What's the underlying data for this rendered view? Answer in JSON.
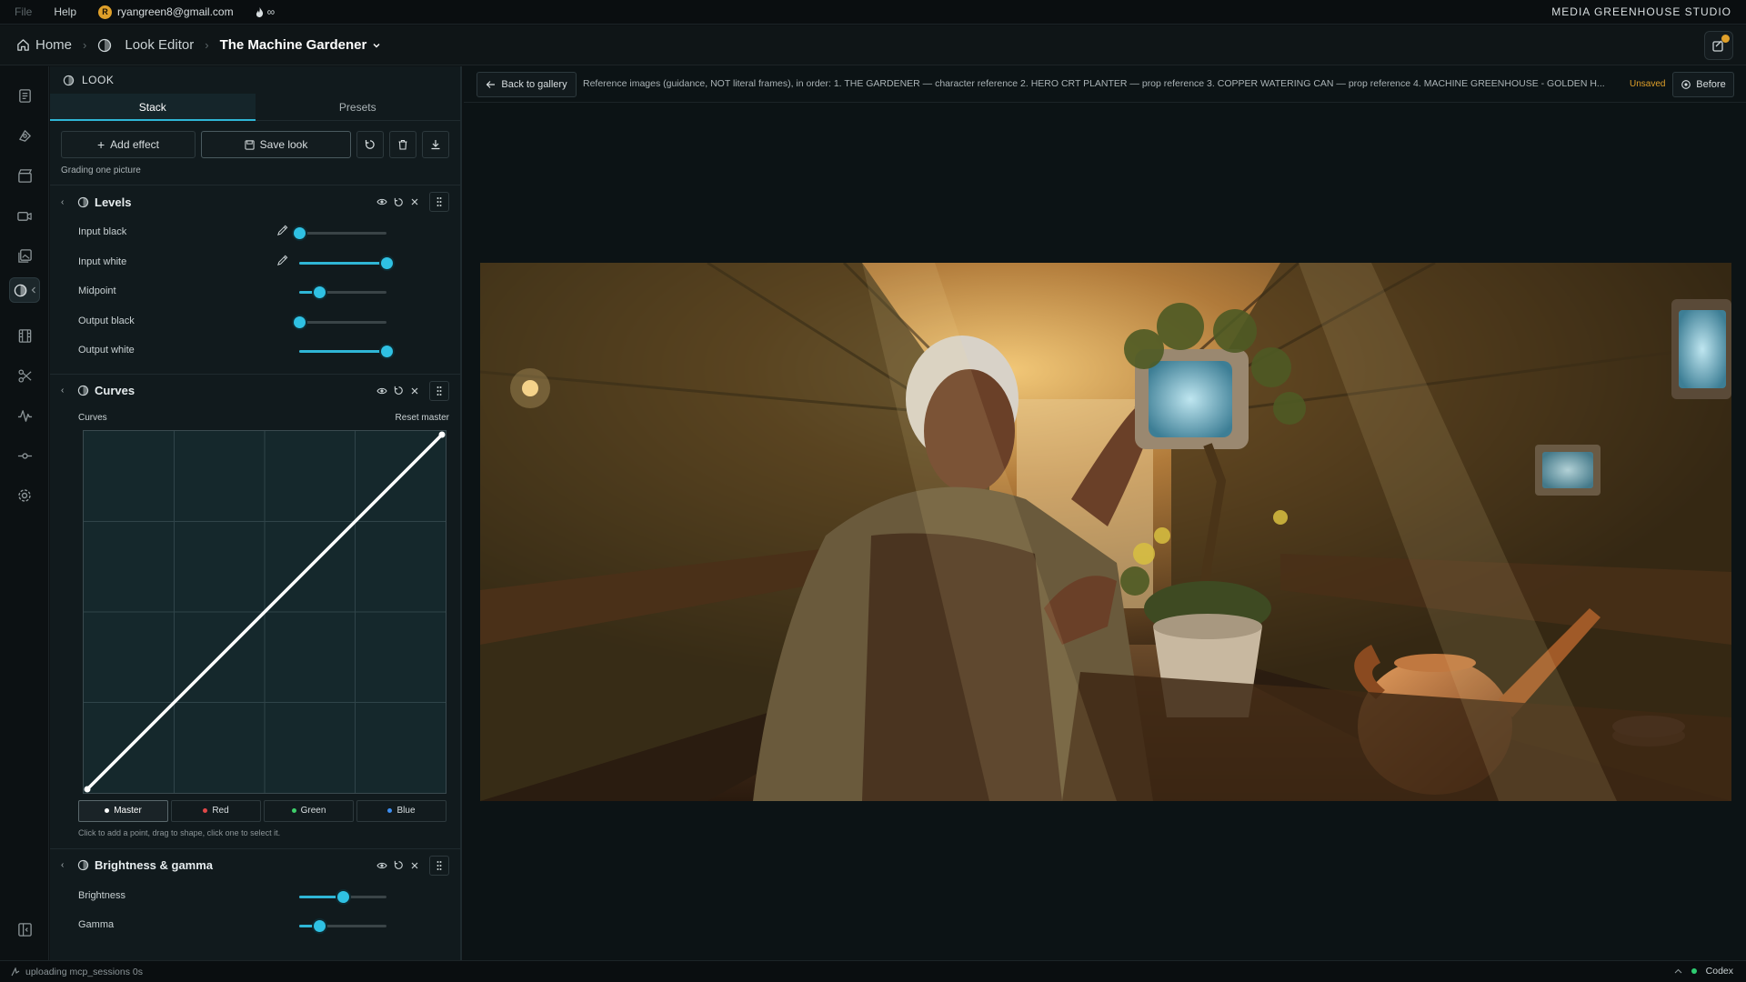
{
  "menubar": {
    "file": "File",
    "help": "Help",
    "user_initial": "R",
    "user_email": "ryangreen8@gmail.com",
    "credits": "∞",
    "studio": "MEDIA GREENHOUSE STUDIO"
  },
  "breadcrumb": {
    "home": "Home",
    "look_editor": "Look Editor",
    "project": "The Machine Gardener"
  },
  "panel": {
    "title": "LOOK",
    "tabs": [
      "Stack",
      "Presets"
    ],
    "add_effect": "Add effect",
    "save_look": "Save look",
    "caption": "Grading one picture"
  },
  "levels": {
    "title": "Levels",
    "rows": [
      {
        "label": "Input black",
        "value": 0
      },
      {
        "label": "Input white",
        "value": 1
      },
      {
        "label": "Midpoint",
        "value": 0.23
      },
      {
        "label": "Output black",
        "value": 0
      },
      {
        "label": "Output white",
        "value": 1
      }
    ]
  },
  "curves": {
    "title": "Curves",
    "label": "Curves",
    "reset": "Reset master",
    "points": [
      [
        0,
        0
      ],
      [
        1,
        1
      ]
    ],
    "channels": [
      {
        "label": "Master",
        "color": "#ffffff"
      },
      {
        "label": "Red",
        "color": "#e04848"
      },
      {
        "label": "Green",
        "color": "#3ecf6a"
      },
      {
        "label": "Blue",
        "color": "#3d8ef0"
      }
    ],
    "hint": "Click to add a point, drag to shape, click one to select it."
  },
  "brightness": {
    "title": "Brightness & gamma",
    "rows": [
      {
        "label": "Brightness",
        "value": 0.5
      },
      {
        "label": "Gamma",
        "value": 0.23
      }
    ]
  },
  "viewer": {
    "back": "Back to gallery",
    "reference": "Reference images (guidance, NOT literal frames), in order: 1. THE GARDENER — character reference 2. HERO CRT PLANTER — prop reference 3. COPPER WATERING CAN — prop reference 4. MACHINE GREENHOUSE - GOLDEN H...",
    "unsaved": "Unsaved",
    "before": "Before"
  },
  "statusbar": {
    "left": "uploading mcp_sessions 0s",
    "right": "Codex"
  },
  "colors": {
    "accent": "#2fb6d6",
    "warning": "#e0a02a"
  }
}
